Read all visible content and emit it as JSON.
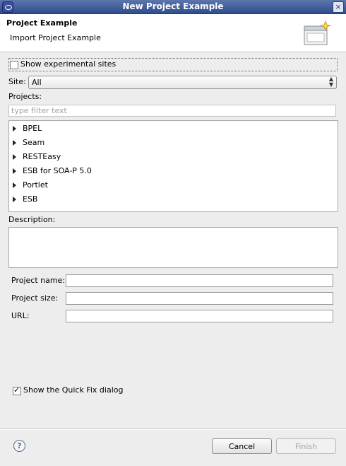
{
  "window": {
    "title": "New Project Example"
  },
  "header": {
    "title": "Project Example",
    "subtitle": "Import Project Example"
  },
  "options": {
    "show_experimental_label": "Show experimental sites",
    "show_experimental_checked": false
  },
  "site": {
    "label": "Site:",
    "value": "All"
  },
  "projects": {
    "label": "Projects:",
    "filter_placeholder": "type filter text",
    "items": [
      {
        "label": "BPEL"
      },
      {
        "label": "Seam"
      },
      {
        "label": "RESTEasy"
      },
      {
        "label": "ESB for SOA-P 5.0"
      },
      {
        "label": "Portlet"
      },
      {
        "label": "ESB"
      }
    ]
  },
  "description": {
    "label": "Description:"
  },
  "details": {
    "project_name_label": "Project name:",
    "project_size_label": "Project size:",
    "url_label": "URL:",
    "project_name_value": "",
    "project_size_value": "",
    "url_value": ""
  },
  "quick_fix": {
    "label": "Show the Quick Fix dialog",
    "checked": true
  },
  "buttons": {
    "cancel": "Cancel",
    "finish": "Finish",
    "help_symbol": "?"
  },
  "icons": {
    "close": "close-icon",
    "app": "app-icon",
    "banner": "project-wizard-icon",
    "help": "help-icon"
  }
}
